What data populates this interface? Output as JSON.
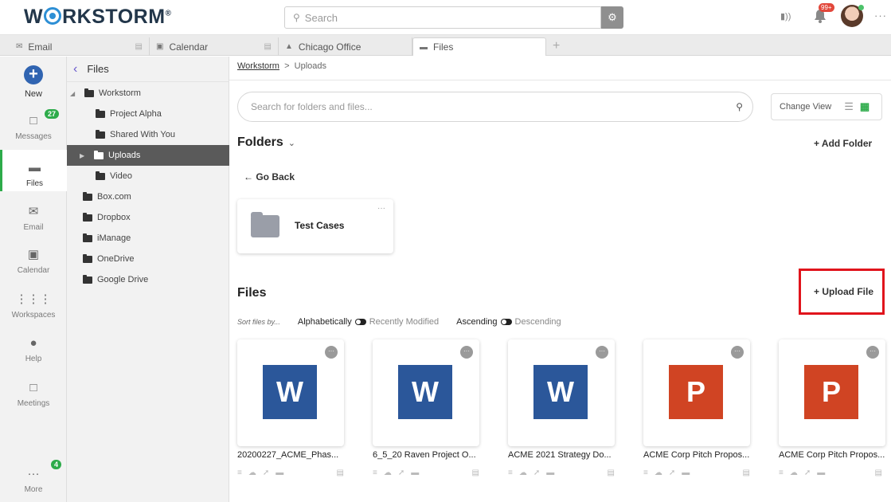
{
  "app": {
    "logo_text": "WORKSTORM",
    "search_placeholder": "Search",
    "notification_badge": "99+",
    "colors": {
      "brand_blue": "#2d8fd5",
      "accent_green": "#2dab4a",
      "word_blue": "#2b579a",
      "ppt_red": "#d04423",
      "highlight_red": "#e0141c"
    }
  },
  "tabs": [
    {
      "label": "Email",
      "icon": "email-icon"
    },
    {
      "label": "Calendar",
      "icon": "calendar-icon"
    },
    {
      "label": "Chicago Office",
      "icon": "org-icon"
    },
    {
      "label": "Files",
      "icon": "folder-icon",
      "active": true
    }
  ],
  "rail": {
    "new_label": "New",
    "messages_label": "Messages",
    "messages_badge": "27",
    "files_label": "Files",
    "email_label": "Email",
    "calendar_label": "Calendar",
    "workspaces_label": "Workspaces",
    "help_label": "Help",
    "meetings_label": "Meetings",
    "more_label": "More",
    "more_badge": "4"
  },
  "tree": {
    "header": "Files",
    "items": [
      {
        "label": "Workstorm"
      },
      {
        "label": "Project Alpha"
      },
      {
        "label": "Shared With You"
      },
      {
        "label": "Uploads",
        "selected": true
      },
      {
        "label": "Video"
      },
      {
        "label": "Box.com"
      },
      {
        "label": "Dropbox"
      },
      {
        "label": "iManage"
      },
      {
        "label": "OneDrive"
      },
      {
        "label": "Google Drive"
      }
    ]
  },
  "main": {
    "breadcrumb_root": "Workstorm",
    "breadcrumb_sep": ">",
    "breadcrumb_current": "Uploads",
    "search_placeholder": "Search for folders and files...",
    "change_view_label": "Change View",
    "folders_heading": "Folders",
    "add_folder_label": "+ Add Folder",
    "go_back_label": "← Go Back",
    "folder_card_name": "Test Cases",
    "files_heading": "Files",
    "upload_file_label": "+ Upload File",
    "sort_by_label": "Sort files by...",
    "sort_alpha": "Alphabetically",
    "sort_recent": "Recently Modified",
    "sort_asc": "Ascending",
    "sort_desc": "Descending"
  },
  "files": [
    {
      "name": "20200227_ACME_Phas...",
      "type": "W"
    },
    {
      "name": "6_5_20 Raven Project O...",
      "type": "W"
    },
    {
      "name": "ACME 2021 Strategy Do...",
      "type": "W"
    },
    {
      "name": "ACME Corp Pitch Propos...",
      "type": "P"
    },
    {
      "name": "ACME Corp Pitch Propos...",
      "type": "P"
    }
  ]
}
